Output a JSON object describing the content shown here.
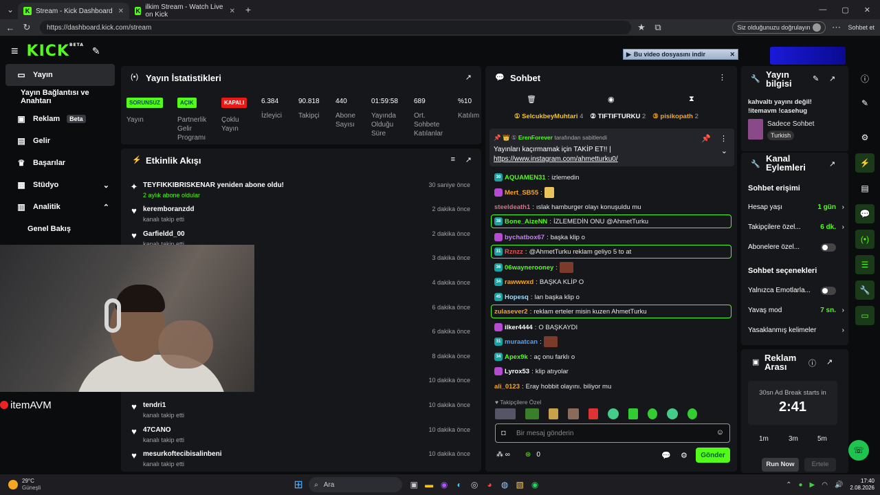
{
  "browser": {
    "tabs": [
      {
        "label": "Stream - Kick Dashboard"
      },
      {
        "label": "ilkim Stream - Watch Live on Kick"
      }
    ],
    "url": "https://dashboard.kick.com/stream",
    "verify": "Siz olduğunuzu doğrulayın",
    "copilot": "Sohbet et"
  },
  "banner": {
    "download": "Bu video dosyasını indir"
  },
  "sidebar": {
    "items": [
      {
        "label": "Yayın"
      },
      {
        "label": "Yayın Bağlantısı ve Anahtarı"
      },
      {
        "label": "Reklam",
        "badge": "Beta"
      },
      {
        "label": "Gelir"
      },
      {
        "label": "Başarılar"
      },
      {
        "label": "Stüdyo"
      },
      {
        "label": "Analitik"
      },
      {
        "label": "Genel Bakış"
      }
    ]
  },
  "stats": {
    "title": "Yayın İstatistikleri",
    "items": [
      {
        "value": "SORUNSUZ",
        "label": "Yayın"
      },
      {
        "value": "AÇIK",
        "label": "Partnerlik Gelir Programı"
      },
      {
        "value": "KAPALI",
        "label": "Çoklu Yayın"
      },
      {
        "value": "6.384",
        "label": "İzleyici"
      },
      {
        "value": "90.818",
        "label": "Takipçi"
      },
      {
        "value": "440",
        "label": "Abone Sayısı"
      },
      {
        "value": "01:59:58",
        "label": "Yayında Olduğu Süre"
      },
      {
        "value": "689",
        "label": "Ort. Sohbete Katılanlar"
      },
      {
        "value": "%10",
        "label": "Katılım"
      }
    ]
  },
  "events": {
    "title": "Etkinlik Akışı",
    "items": [
      {
        "name": "TEYFIKKIBRISKENAR yeniden abone oldu!",
        "sub": "2 aylık abone oldular",
        "time": "30 saniye önce"
      },
      {
        "name": "keremboranzdd",
        "sub": "kanalı takip etti",
        "time": "2 dakika önce"
      },
      {
        "name": "Garfieldd_00",
        "sub": "kanalı takip etti",
        "time": "2 dakika önce"
      },
      {
        "name": "",
        "sub": "",
        "time": "3 dakika önce"
      },
      {
        "name": "",
        "sub": "",
        "time": "4 dakika önce"
      },
      {
        "name": "",
        "sub": "",
        "time": "6 dakika önce"
      },
      {
        "name": "",
        "sub": "",
        "time": "6 dakika önce"
      },
      {
        "name": "",
        "sub": "",
        "time": "8 dakika önce"
      },
      {
        "name": "",
        "sub": "",
        "time": "10 dakika önce"
      },
      {
        "name": "tendri1",
        "sub": "kanalı takip etti",
        "time": "10 dakika önce"
      },
      {
        "name": "47CANO",
        "sub": "kanalı takip etti",
        "time": "10 dakika önce"
      },
      {
        "name": "mesurkoftecibisalinbeni",
        "sub": "kanalı takip etti",
        "time": "10 dakika önce"
      }
    ]
  },
  "cam": {
    "brand": "itemAVM"
  },
  "chat": {
    "title": "Sohbet",
    "top": [
      {
        "name": "SelcukbeyMuhtari",
        "n": "4"
      },
      {
        "name": "TIFTIFTURKU",
        "n": "2"
      },
      {
        "name": "pisikopath",
        "n": "2"
      }
    ],
    "pinned": {
      "by": "ErenForever",
      "by_suffix": "tarafından sabitlendi",
      "text": "Yayınları kaçırmamak için TAKİP ET!! |",
      "link": "https://www.instagram.com/ahmetturku0/"
    },
    "messages": [
      {
        "user": "AQUAMEN31",
        "text": "izlemedin",
        "color": "#53fc18",
        "badge": "30"
      },
      {
        "user": "Mert_SB55",
        "text": "",
        "color": "#f5a623",
        "badge": ""
      },
      {
        "user": "steeldeath1",
        "text": "ıslak hamburger olayı konuşuldu mu",
        "color": "#e06c8a",
        "badge": ""
      },
      {
        "user": "Bone_AizeNN",
        "text": "İZLEMEDİN ONU @AhmetTurku",
        "color": "#53fc18",
        "badge": "38"
      },
      {
        "user": "bychatbox67",
        "text": "başka klip o",
        "color": "#c77dff",
        "badge": ""
      },
      {
        "user": "Rznzz",
        "text": "@AhmetTurku reklam geliyo 5 to at",
        "color": "#e05555",
        "badge": "31"
      },
      {
        "user": "06wayneroоney",
        "text": "",
        "color": "#53fc18",
        "badge": "36"
      },
      {
        "user": "rawwwxd",
        "text": "BAŞKA KLİP O",
        "color": "#f5a623",
        "badge": "34"
      },
      {
        "user": "Hopesq",
        "text": "lan başka klip o",
        "color": "#9cdcfe",
        "badge": "45"
      },
      {
        "user": "zulasever2",
        "text": "reklam erteler misin kuzen AhmetTurku",
        "color": "#f5a623",
        "badge": ""
      },
      {
        "user": "ilker4444",
        "text": "O BAŞKAYDI",
        "color": "#fff",
        "badge": ""
      },
      {
        "user": "muraatcan",
        "text": "",
        "color": "#4aa3ff",
        "badge": "31"
      },
      {
        "user": "Apex9k",
        "text": "aç onu farklı o",
        "color": "#53fc18",
        "badge": "34"
      },
      {
        "user": "Lyrox53",
        "text": "klip atıyolar",
        "color": "#fff",
        "badge": ""
      },
      {
        "user": "ali_0123",
        "text": "Eray hobbit olayını. biliyor mu",
        "color": "#f5a623",
        "badge": ""
      }
    ],
    "emote_label": "Takipçilere Özel",
    "input_placeholder": "Bir mesaj gönderin",
    "points": "0",
    "send": "Gönder"
  },
  "info": {
    "title": "Yayın bilgisi",
    "stream_title": "kahvaltı yayını değil! !itemavm !casehug",
    "category": "Sadece Sohbet",
    "language": "Turkish"
  },
  "actions": {
    "title": "Kanal Eylemleri",
    "access": "Sohbet erişimi",
    "account_age": "Hesap yaşı",
    "account_age_v": "1 gün",
    "followers": "Takipçilere özel...",
    "followers_v": "6 dk.",
    "subs": "Abonelere özel...",
    "options": "Sohbet seçenekleri",
    "emotes": "Yalnızca Emotlarla...",
    "slow": "Yavaş mod",
    "slow_v": "7 sn.",
    "banned": "Yasaklanmış kelimeler"
  },
  "ad": {
    "title": "Reklam Arası",
    "starts": "30sn Ad Break starts in",
    "timer": "2:41",
    "opts": [
      "1m",
      "3m",
      "5m"
    ],
    "run": "Run Now",
    "later": "Ertele"
  },
  "taskbar": {
    "temp": "29°C",
    "weather": "Güneşli",
    "search": "Ara",
    "time": "17:40",
    "date": "2.08.2026"
  }
}
